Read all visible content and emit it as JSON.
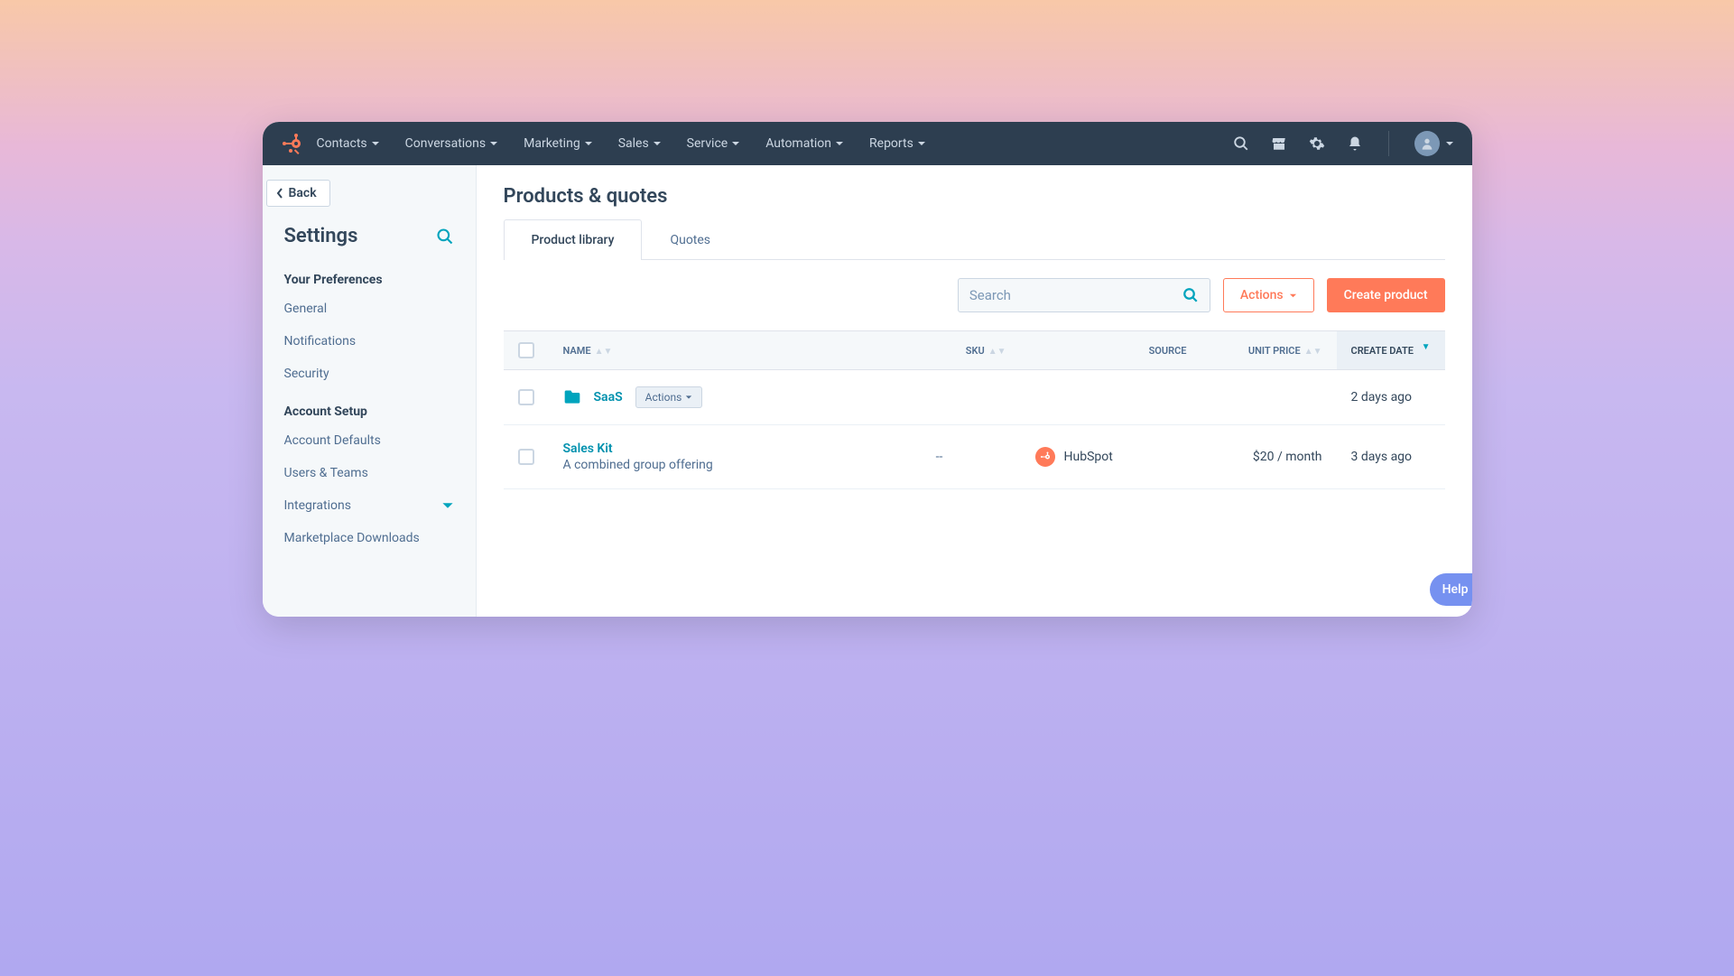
{
  "nav": {
    "items": [
      "Contacts",
      "Conversations",
      "Marketing",
      "Sales",
      "Service",
      "Automation",
      "Reports"
    ]
  },
  "sidebar": {
    "back": "Back",
    "title": "Settings",
    "sections": [
      {
        "heading": "Your Preferences",
        "links": [
          {
            "label": "General"
          },
          {
            "label": "Notifications"
          },
          {
            "label": "Security"
          }
        ]
      },
      {
        "heading": "Account Setup",
        "links": [
          {
            "label": "Account Defaults"
          },
          {
            "label": "Users & Teams"
          },
          {
            "label": "Integrations",
            "expandable": true
          },
          {
            "label": "Marketplace Downloads"
          }
        ]
      }
    ]
  },
  "page": {
    "title": "Products & quotes",
    "tabs": [
      "Product library",
      "Quotes"
    ],
    "search_placeholder": "Search",
    "actions_label": "Actions",
    "create_label": "Create product"
  },
  "table": {
    "columns": {
      "name": "NAME",
      "sku": "SKU",
      "source": "SOURCE",
      "unit_price": "UNIT PRICE",
      "create_date": "CREATE DATE"
    },
    "rows": [
      {
        "type": "folder",
        "name": "SaaS",
        "actions": "Actions",
        "sku": "",
        "source": "",
        "unit_price": "",
        "create_date": "2 days ago"
      },
      {
        "type": "product",
        "name": "Sales Kit",
        "description": "A combined group offering",
        "sku": "--",
        "source": "HubSpot",
        "unit_price": "$20 / month",
        "create_date": "3 days ago"
      }
    ]
  },
  "help_label": "Help"
}
